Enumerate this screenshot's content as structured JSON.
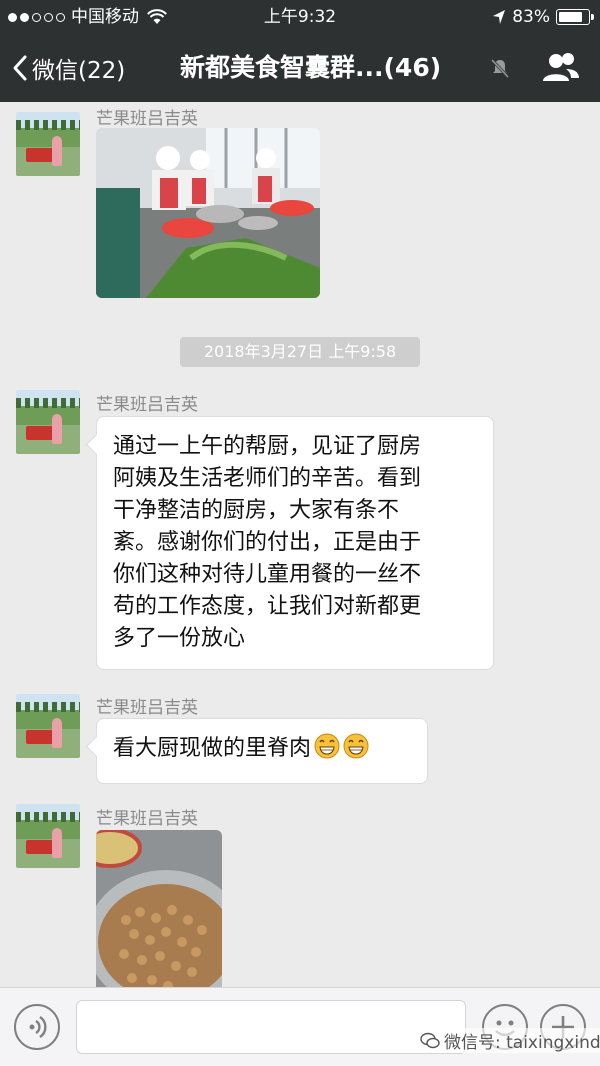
{
  "status_bar": {
    "carrier": "中国移动",
    "time": "上午9:32",
    "battery": "83%",
    "battery_level": 0.83
  },
  "nav": {
    "back_label": "微信(22)",
    "title": "新都美食智囊群...(46)"
  },
  "messages": [
    {
      "sender": "芒果班吕吉英",
      "type": "image",
      "image_desc": "kitchen-staff-photo"
    },
    {
      "type": "timestamp",
      "text": "2018年3月27日 上午9:58"
    },
    {
      "sender": "芒果班吕吉英",
      "type": "text",
      "lines": [
        "通过一上午的帮厨，见证了厨房",
        "阿姨及生活老师们的辛苦。看到",
        "干净整洁的厨房，大家有条不",
        "紊。感谢你们的付出，正是由于",
        "你们这种对待儿童用餐的一丝不",
        "苟的工作态度，让我们对新都更",
        "多了一份放心"
      ]
    },
    {
      "sender": "芒果班吕吉英",
      "type": "text",
      "text": "看大厨现做的里脊肉",
      "emoji_count": 2
    },
    {
      "sender": "芒果班吕吉英",
      "type": "image",
      "image_desc": "pork-tenderloin-photo"
    }
  ],
  "input_bar": {
    "value": ""
  },
  "watermark": "微信号: taixingxindu",
  "colors": {
    "header_bg": "#2e3132",
    "chat_bg": "#ebebeb",
    "bubble_bg": "#ffffff",
    "timestamp_bg": "#cecece"
  }
}
